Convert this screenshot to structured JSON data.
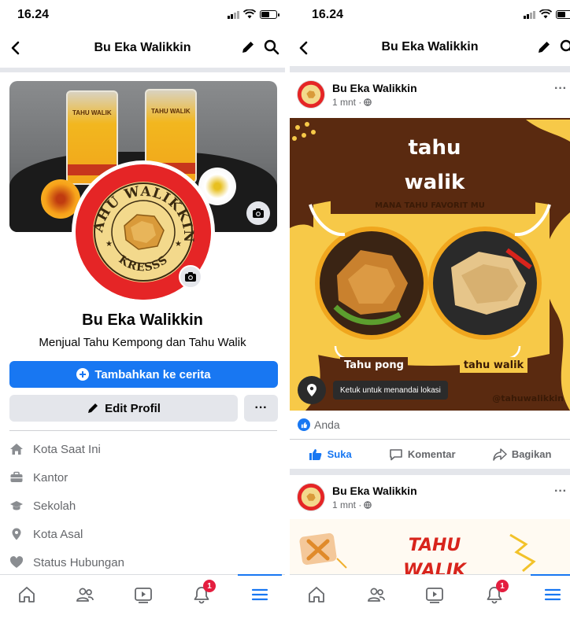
{
  "status": {
    "time": "16.24"
  },
  "profile": {
    "nav_title": "Bu Eka Walikkin",
    "cover_packs": [
      {
        "label": "TAHU WALIK"
      },
      {
        "label": "TAHU WALIK"
      }
    ],
    "avatar_text_top": "TAHU WALIKKIN",
    "avatar_text_bottom": "KRESSS",
    "name": "Bu Eka Walikkin",
    "bio": "Menjual Tahu Kempong dan Tahu Walik",
    "add_story_label": "Tambahkan ke cerita",
    "edit_profile_label": "Edit Profil",
    "more_label": "···",
    "info_items": [
      {
        "icon": "home-icon",
        "label": "Kota Saat Ini"
      },
      {
        "icon": "briefcase-icon",
        "label": "Kantor"
      },
      {
        "icon": "graduation-cap-icon",
        "label": "Sekolah"
      },
      {
        "icon": "location-pin-icon",
        "label": "Kota Asal"
      },
      {
        "icon": "heart-icon",
        "label": "Status Hubungan"
      }
    ]
  },
  "feed": {
    "nav_title": "Bu Eka Walikkin",
    "posts": [
      {
        "author": "Bu Eka Walikkin",
        "time": "1 mnt · ",
        "image": {
          "title_line1": "tahu",
          "title_line2": "walik",
          "subtitle": "MANA TAHU FAVORIT MU",
          "label_left": "Tahu pong",
          "label_right": "tahu walik",
          "location_hint": "Ketuk untuk menandai lokasi",
          "handle": "@tahuwalikkin"
        },
        "reactions": "Anda",
        "actions": {
          "like": "Suka",
          "comment": "Komentar",
          "share": "Bagikan"
        }
      },
      {
        "author": "Bu Eka Walikkin",
        "time": "1 mnt · ",
        "image": {
          "title_line1": "TAHU",
          "title_line2": "WALIK"
        }
      }
    ]
  },
  "tabbar": {
    "notification_count": "1"
  },
  "colors": {
    "brand_blue": "#1877f2",
    "badge_red": "#e41e3f",
    "poster_yellow": "#f7c948",
    "poster_brown": "#5a2a10"
  }
}
